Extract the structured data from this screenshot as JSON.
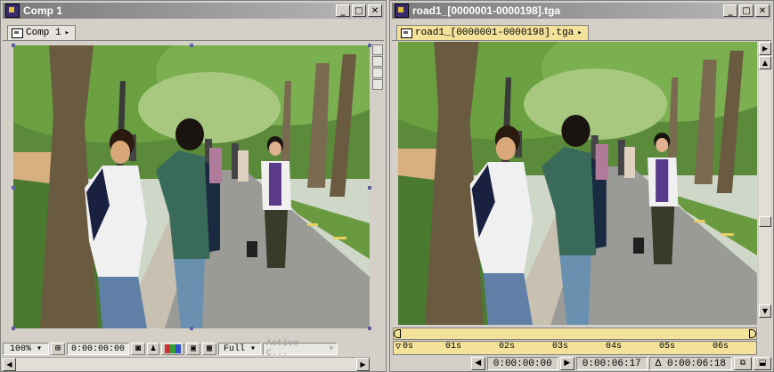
{
  "comp_window": {
    "title": "Comp 1",
    "tab_label": "Comp 1",
    "zoom": "100%",
    "timecode": "0:00:00:00",
    "resolution": "Full",
    "camera": "Active C..."
  },
  "footage_window": {
    "title": "road1_[0000001-0000198].tga",
    "tab_label": "road1_[0000001-0000198].tga",
    "ruler_ticks": [
      "0s",
      "01s",
      "02s",
      "03s",
      "04s",
      "05s",
      "06s"
    ],
    "in_time": "0:00:00:00",
    "out_time": "0:00:06:17",
    "duration": "Δ 0:00:06:18"
  },
  "window_controls": {
    "minimize": "_",
    "maximize": "□",
    "close": "✕"
  },
  "colors": {
    "title_bar": "#7a7a7a",
    "footage_tab": "#f4e29a",
    "panel": "#d4d0c8"
  }
}
